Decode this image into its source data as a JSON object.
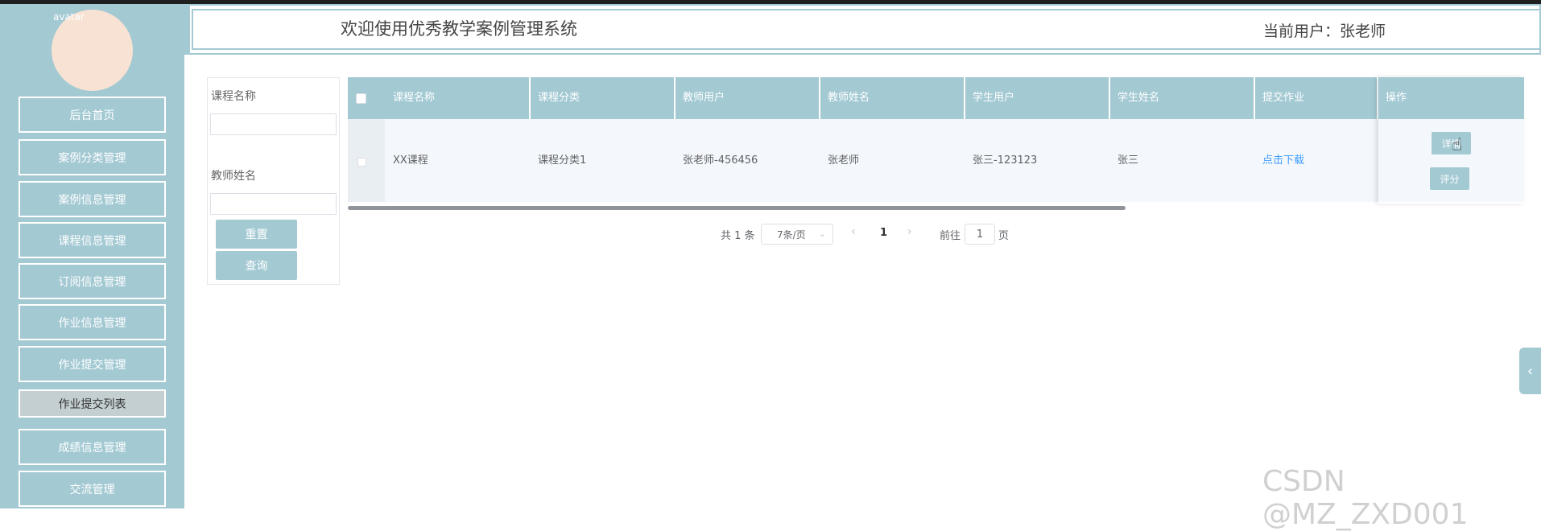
{
  "header": {
    "system_title": "欢迎使用优秀教学案例管理系统",
    "current_user": "当前用户：张老师"
  },
  "sidebar": {
    "avatar_alt": "avatar",
    "items": [
      {
        "label": "后台首页"
      },
      {
        "label": "案例分类管理"
      },
      {
        "label": "案例信息管理"
      },
      {
        "label": "课程信息管理"
      },
      {
        "label": "订阅信息管理"
      },
      {
        "label": "作业信息管理"
      },
      {
        "label": "作业提交管理"
      },
      {
        "label": "作业提交列表",
        "active": true
      },
      {
        "label": "成绩信息管理"
      },
      {
        "label": "交流管理"
      }
    ]
  },
  "filter": {
    "course_name_label": "课程名称",
    "course_name_value": "",
    "teacher_name_label": "教师姓名",
    "teacher_name_value": "",
    "reset_label": "重置",
    "query_label": "查询"
  },
  "table": {
    "columns": [
      "课程名称",
      "课程分类",
      "教师用户",
      "教师姓名",
      "学生用户",
      "学生姓名",
      "提交作业",
      "操作"
    ],
    "rows": [
      {
        "course_name": "XX课程",
        "course_category": "课程分类1",
        "teacher_user": "张老师-456456",
        "teacher_name": "张老师",
        "student_user": "张三-123123",
        "student_name": "张三",
        "submit_homework": "点击下载",
        "detail_label": "详情",
        "grade_label": "评分"
      }
    ]
  },
  "pagination": {
    "total": "共 1 条",
    "page_size": "7条/页",
    "current_page": "1",
    "goto_prefix": "前往",
    "goto_value": "1",
    "goto_suffix": "页"
  },
  "watermark": "CSDN @MZ_ZXD001",
  "colors": {
    "accent": "#a3c9d3",
    "link": "#409eff"
  }
}
